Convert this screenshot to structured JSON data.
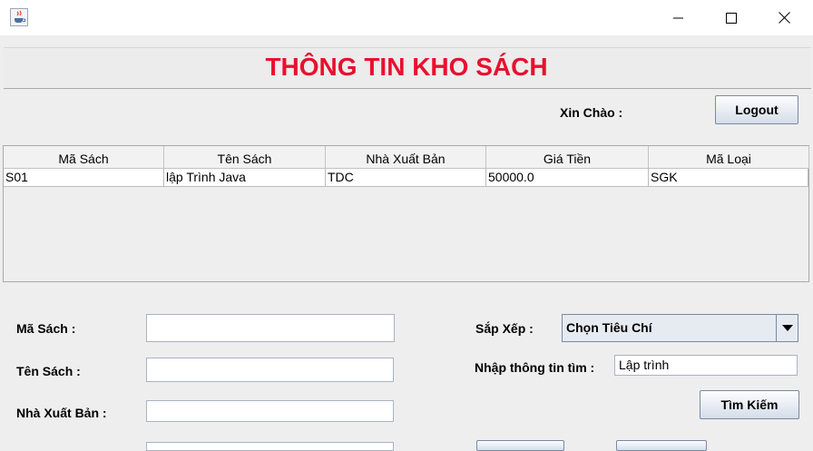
{
  "window": {
    "title": ""
  },
  "header": {
    "title": "THÔNG TIN KHO SÁCH"
  },
  "greeting": {
    "label": "Xin Chào :"
  },
  "logout": {
    "label": "Logout"
  },
  "table": {
    "columns": [
      "Mã Sách",
      "Tên Sách",
      "Nhà Xuất Bản",
      "Giá Tiền",
      "Mã Loại"
    ],
    "rows": [
      [
        "S01",
        "lập Trình Java",
        "TDC",
        "50000.0",
        "SGK"
      ]
    ]
  },
  "form": {
    "ma_sach_label": "Mã Sách :",
    "ten_sach_label": "Tên Sách :",
    "nxb_label": "Nhà Xuất Bản :",
    "ma_sach_value": "",
    "ten_sach_value": "",
    "nxb_value": ""
  },
  "search": {
    "sort_label": "Sắp Xếp :",
    "sort_selected": "Chọn Tiêu Chí",
    "input_label": "Nhập thông tin tìm :",
    "input_value": "Lập trình",
    "button_label": "Tìm Kiếm"
  },
  "icons": {
    "app": "java-cup-icon",
    "minimize": "minimize-icon",
    "maximize": "maximize-icon",
    "close": "close-icon",
    "dropdown": "triangle-down-icon"
  }
}
